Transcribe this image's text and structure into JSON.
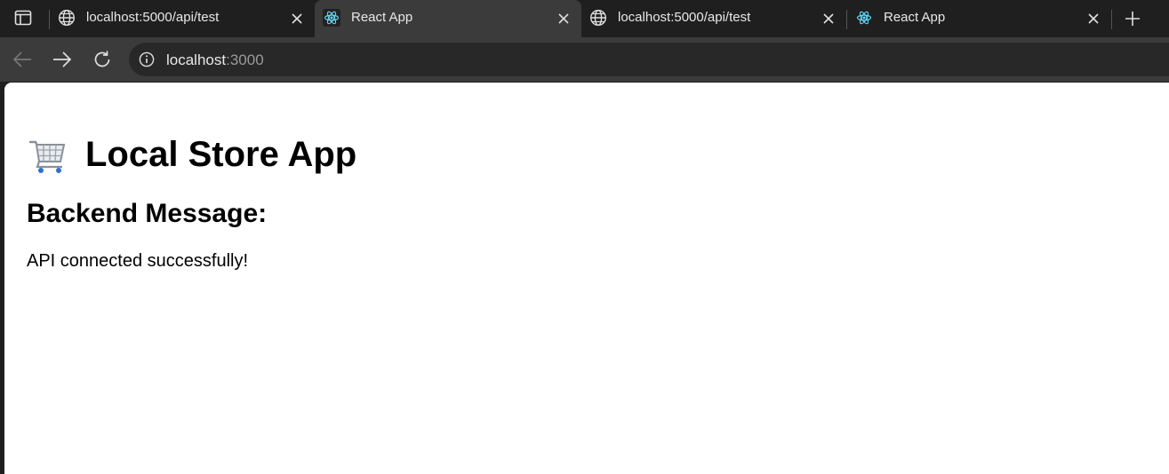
{
  "tabs": [
    {
      "title": "localhost:5000/api/test",
      "icon": "globe-icon",
      "active": false
    },
    {
      "title": "React App",
      "icon": "react-icon",
      "active": true
    },
    {
      "title": "localhost:5000/api/test",
      "icon": "globe-icon",
      "active": false
    },
    {
      "title": "React App",
      "icon": "react-icon",
      "active": false
    }
  ],
  "address_bar": {
    "host": "localhost",
    "port": ":3000"
  },
  "page": {
    "title": "Local Store App",
    "title_icon": "shopping-cart-icon",
    "section_heading": "Backend Message:",
    "message": "API connected successfully!"
  },
  "colors": {
    "chrome_dark": "#1f1f1f",
    "chrome_toolbar": "#3b3b3b",
    "react_blue": "#61dafb"
  }
}
